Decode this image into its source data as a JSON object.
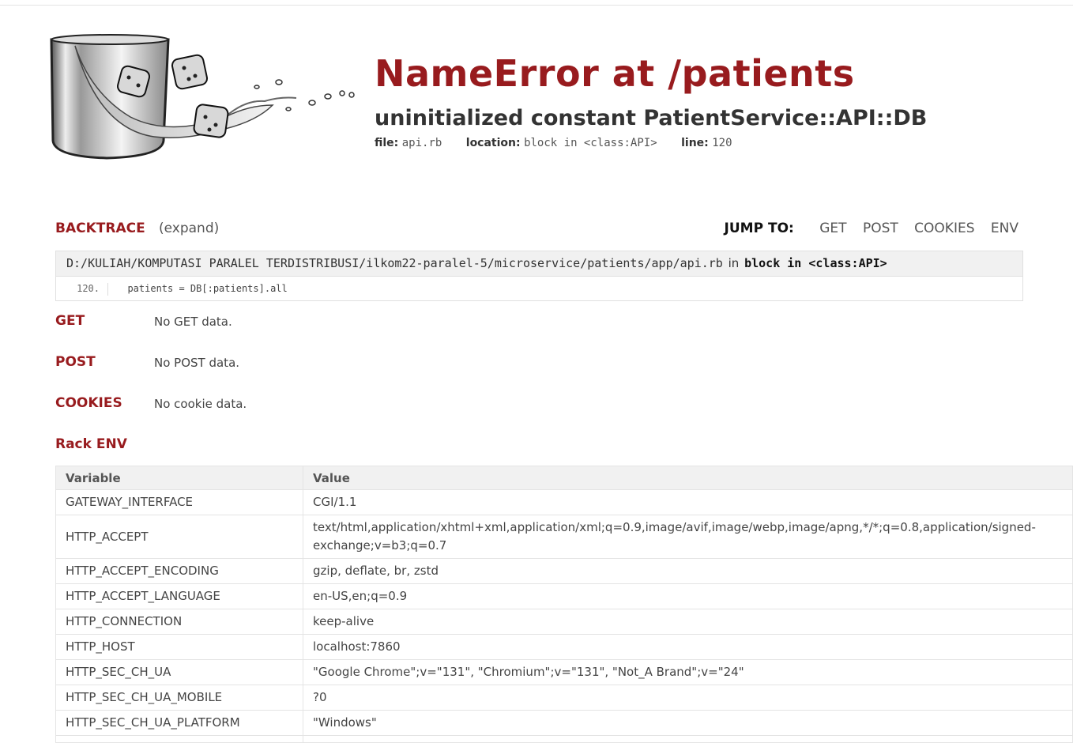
{
  "error": {
    "title": "NameError at /patients",
    "message": "uninitialized constant PatientService::API::DB",
    "file_label": "file:",
    "file": "api.rb",
    "location_label": "location:",
    "location": "block in <class:API>",
    "line_label": "line:",
    "line": "120"
  },
  "backtrace": {
    "heading": "BACKTRACE",
    "expand": "(expand)",
    "frame_path": "D:/KULIAH/KOMPUTASI PARALEL TERDISTRIBUSI/ilkom22-paralel-5/microservice/patients/app/api.rb",
    "frame_in": "in",
    "frame_context": "block in <class:API>",
    "line_number": "120.",
    "code": "  patients = DB[:patients].all"
  },
  "jump": {
    "label": "JUMP TO:",
    "links": [
      "GET",
      "POST",
      "COOKIES",
      "ENV"
    ]
  },
  "sections": {
    "get_heading": "GET",
    "get_value": "No GET data.",
    "post_heading": "POST",
    "post_value": "No POST data.",
    "cookies_heading": "COOKIES",
    "cookies_value": "No cookie data.",
    "env_heading": "Rack ENV"
  },
  "env_table": {
    "headers": [
      "Variable",
      "Value"
    ],
    "rows": [
      [
        "GATEWAY_INTERFACE",
        "CGI/1.1"
      ],
      [
        "HTTP_ACCEPT",
        "text/html,application/xhtml+xml,application/xml;q=0.9,image/avif,image/webp,image/apng,*/*;q=0.8,application/signed-exchange;v=b3;q=0.7"
      ],
      [
        "HTTP_ACCEPT_ENCODING",
        "gzip, deflate, br, zstd"
      ],
      [
        "HTTP_ACCEPT_LANGUAGE",
        "en-US,en;q=0.9"
      ],
      [
        "HTTP_CONNECTION",
        "keep-alive"
      ],
      [
        "HTTP_HOST",
        "localhost:7860"
      ],
      [
        "HTTP_SEC_CH_UA",
        "\"Google Chrome\";v=\"131\", \"Chromium\";v=\"131\", \"Not_A Brand\";v=\"24\""
      ],
      [
        "HTTP_SEC_CH_UA_MOBILE",
        "?0"
      ],
      [
        "HTTP_SEC_CH_UA_PLATFORM",
        "\"Windows\""
      ],
      [
        "",
        ""
      ]
    ]
  },
  "colors": {
    "accent": "#981b1e",
    "text": "#333333",
    "header_bg": "#f1f1f1",
    "border": "#e4e4e4"
  },
  "icons": {
    "logo": "sinatra-glass-dice-logo"
  }
}
